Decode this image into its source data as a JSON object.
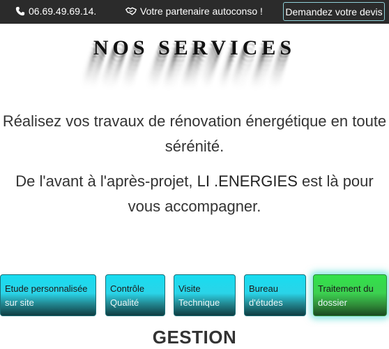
{
  "topbar": {
    "phone": "06.69.49.69.14.",
    "tagline": "Votre partenaire autoconso !",
    "cta": "Demandez votre devis",
    "icons": [
      "phone-icon",
      "handshake-icon"
    ]
  },
  "section": {
    "title": "NOS SERVICES",
    "intro_line1": "Réalisez vos travaux de rénovation énergétique en toute",
    "intro_line2": "sérénité.",
    "support_line1_prefix": "De l'avant à l'après-projet,",
    "brand": "LI .ENERGIES",
    "support_line1_suffix": "est là pour",
    "support_line2": "vous accompagner."
  },
  "services": [
    {
      "line1": "Etude personnalisée",
      "line2": "sur site"
    },
    {
      "line1": "Contrôle",
      "line2": "Qualité"
    },
    {
      "line1": "Visite",
      "line2": "Technique"
    },
    {
      "line1": "Bureau",
      "line2": "d'études"
    },
    {
      "line1": "Traitement du",
      "line2": "dossier"
    }
  ],
  "heading_next": "GESTION",
  "colors": {
    "topbar_bg": "#2b2b2b",
    "service_cyan": "#18dcf0",
    "service_active_green": "#32e24a"
  }
}
